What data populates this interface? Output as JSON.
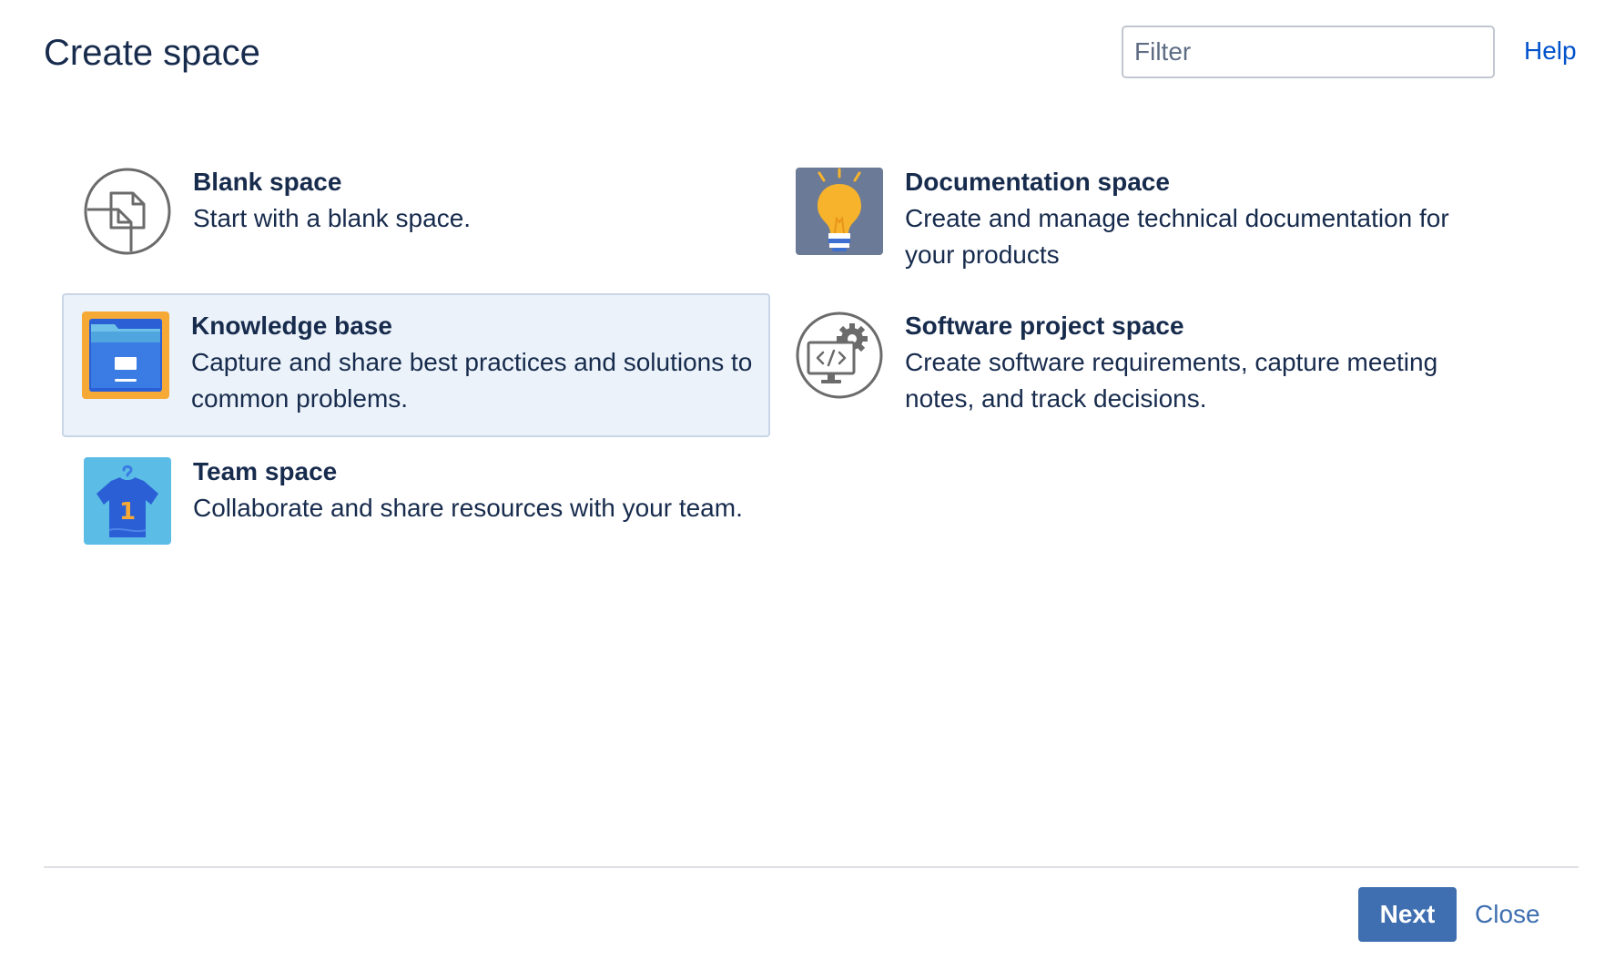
{
  "dialog": {
    "title": "Create space",
    "filter_placeholder": "Filter",
    "help_label": "Help"
  },
  "templates": [
    {
      "name": "Blank space",
      "description": "Start with a blank space.",
      "icon": "blank-page-icon",
      "selected": false
    },
    {
      "name": "Documentation space",
      "description": "Create and manage technical documentation for your products",
      "icon": "lightbulb-icon",
      "selected": false
    },
    {
      "name": "Knowledge base",
      "description": "Capture and share best practices and solutions to common problems.",
      "icon": "folder-cabinet-icon",
      "selected": true
    },
    {
      "name": "Software project space",
      "description": "Create software requirements, capture meeting notes, and track decisions.",
      "icon": "code-gear-icon",
      "selected": false
    },
    {
      "name": "Team space",
      "description": "Collaborate and share resources with your team.",
      "icon": "team-shirt-icon",
      "selected": false
    }
  ],
  "footer": {
    "next_label": "Next",
    "close_label": "Close"
  },
  "colors": {
    "primary_button": "#3f6fb0",
    "link": "#0052cc",
    "selected_background": "#ebf2f9",
    "selected_border": "#c9d6e8"
  }
}
